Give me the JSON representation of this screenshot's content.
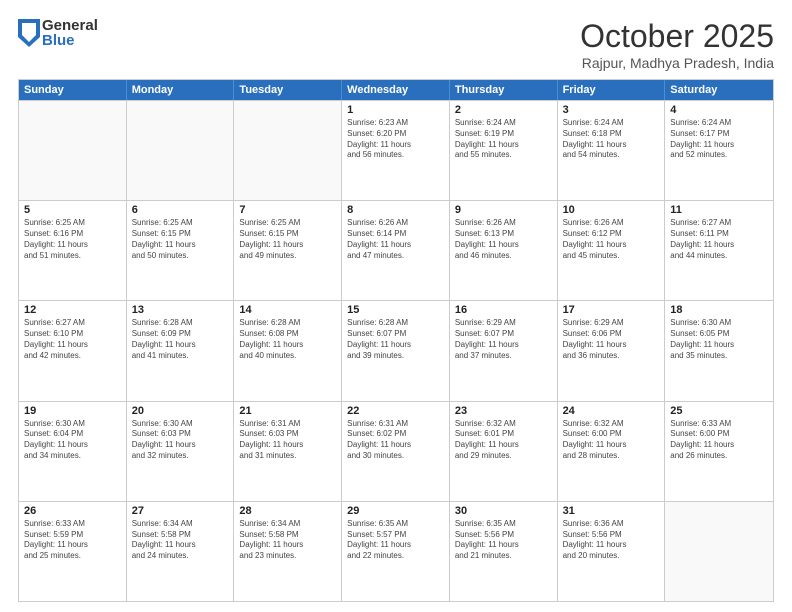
{
  "header": {
    "logo_general": "General",
    "logo_blue": "Blue",
    "month_title": "October 2025",
    "location": "Rajpur, Madhya Pradesh, India"
  },
  "days_of_week": [
    "Sunday",
    "Monday",
    "Tuesday",
    "Wednesday",
    "Thursday",
    "Friday",
    "Saturday"
  ],
  "weeks": [
    [
      {
        "day": "",
        "info": ""
      },
      {
        "day": "",
        "info": ""
      },
      {
        "day": "",
        "info": ""
      },
      {
        "day": "1",
        "info": "Sunrise: 6:23 AM\nSunset: 6:20 PM\nDaylight: 11 hours\nand 56 minutes."
      },
      {
        "day": "2",
        "info": "Sunrise: 6:24 AM\nSunset: 6:19 PM\nDaylight: 11 hours\nand 55 minutes."
      },
      {
        "day": "3",
        "info": "Sunrise: 6:24 AM\nSunset: 6:18 PM\nDaylight: 11 hours\nand 54 minutes."
      },
      {
        "day": "4",
        "info": "Sunrise: 6:24 AM\nSunset: 6:17 PM\nDaylight: 11 hours\nand 52 minutes."
      }
    ],
    [
      {
        "day": "5",
        "info": "Sunrise: 6:25 AM\nSunset: 6:16 PM\nDaylight: 11 hours\nand 51 minutes."
      },
      {
        "day": "6",
        "info": "Sunrise: 6:25 AM\nSunset: 6:15 PM\nDaylight: 11 hours\nand 50 minutes."
      },
      {
        "day": "7",
        "info": "Sunrise: 6:25 AM\nSunset: 6:15 PM\nDaylight: 11 hours\nand 49 minutes."
      },
      {
        "day": "8",
        "info": "Sunrise: 6:26 AM\nSunset: 6:14 PM\nDaylight: 11 hours\nand 47 minutes."
      },
      {
        "day": "9",
        "info": "Sunrise: 6:26 AM\nSunset: 6:13 PM\nDaylight: 11 hours\nand 46 minutes."
      },
      {
        "day": "10",
        "info": "Sunrise: 6:26 AM\nSunset: 6:12 PM\nDaylight: 11 hours\nand 45 minutes."
      },
      {
        "day": "11",
        "info": "Sunrise: 6:27 AM\nSunset: 6:11 PM\nDaylight: 11 hours\nand 44 minutes."
      }
    ],
    [
      {
        "day": "12",
        "info": "Sunrise: 6:27 AM\nSunset: 6:10 PM\nDaylight: 11 hours\nand 42 minutes."
      },
      {
        "day": "13",
        "info": "Sunrise: 6:28 AM\nSunset: 6:09 PM\nDaylight: 11 hours\nand 41 minutes."
      },
      {
        "day": "14",
        "info": "Sunrise: 6:28 AM\nSunset: 6:08 PM\nDaylight: 11 hours\nand 40 minutes."
      },
      {
        "day": "15",
        "info": "Sunrise: 6:28 AM\nSunset: 6:07 PM\nDaylight: 11 hours\nand 39 minutes."
      },
      {
        "day": "16",
        "info": "Sunrise: 6:29 AM\nSunset: 6:07 PM\nDaylight: 11 hours\nand 37 minutes."
      },
      {
        "day": "17",
        "info": "Sunrise: 6:29 AM\nSunset: 6:06 PM\nDaylight: 11 hours\nand 36 minutes."
      },
      {
        "day": "18",
        "info": "Sunrise: 6:30 AM\nSunset: 6:05 PM\nDaylight: 11 hours\nand 35 minutes."
      }
    ],
    [
      {
        "day": "19",
        "info": "Sunrise: 6:30 AM\nSunset: 6:04 PM\nDaylight: 11 hours\nand 34 minutes."
      },
      {
        "day": "20",
        "info": "Sunrise: 6:30 AM\nSunset: 6:03 PM\nDaylight: 11 hours\nand 32 minutes."
      },
      {
        "day": "21",
        "info": "Sunrise: 6:31 AM\nSunset: 6:03 PM\nDaylight: 11 hours\nand 31 minutes."
      },
      {
        "day": "22",
        "info": "Sunrise: 6:31 AM\nSunset: 6:02 PM\nDaylight: 11 hours\nand 30 minutes."
      },
      {
        "day": "23",
        "info": "Sunrise: 6:32 AM\nSunset: 6:01 PM\nDaylight: 11 hours\nand 29 minutes."
      },
      {
        "day": "24",
        "info": "Sunrise: 6:32 AM\nSunset: 6:00 PM\nDaylight: 11 hours\nand 28 minutes."
      },
      {
        "day": "25",
        "info": "Sunrise: 6:33 AM\nSunset: 6:00 PM\nDaylight: 11 hours\nand 26 minutes."
      }
    ],
    [
      {
        "day": "26",
        "info": "Sunrise: 6:33 AM\nSunset: 5:59 PM\nDaylight: 11 hours\nand 25 minutes."
      },
      {
        "day": "27",
        "info": "Sunrise: 6:34 AM\nSunset: 5:58 PM\nDaylight: 11 hours\nand 24 minutes."
      },
      {
        "day": "28",
        "info": "Sunrise: 6:34 AM\nSunset: 5:58 PM\nDaylight: 11 hours\nand 23 minutes."
      },
      {
        "day": "29",
        "info": "Sunrise: 6:35 AM\nSunset: 5:57 PM\nDaylight: 11 hours\nand 22 minutes."
      },
      {
        "day": "30",
        "info": "Sunrise: 6:35 AM\nSunset: 5:56 PM\nDaylight: 11 hours\nand 21 minutes."
      },
      {
        "day": "31",
        "info": "Sunrise: 6:36 AM\nSunset: 5:56 PM\nDaylight: 11 hours\nand 20 minutes."
      },
      {
        "day": "",
        "info": ""
      }
    ]
  ]
}
